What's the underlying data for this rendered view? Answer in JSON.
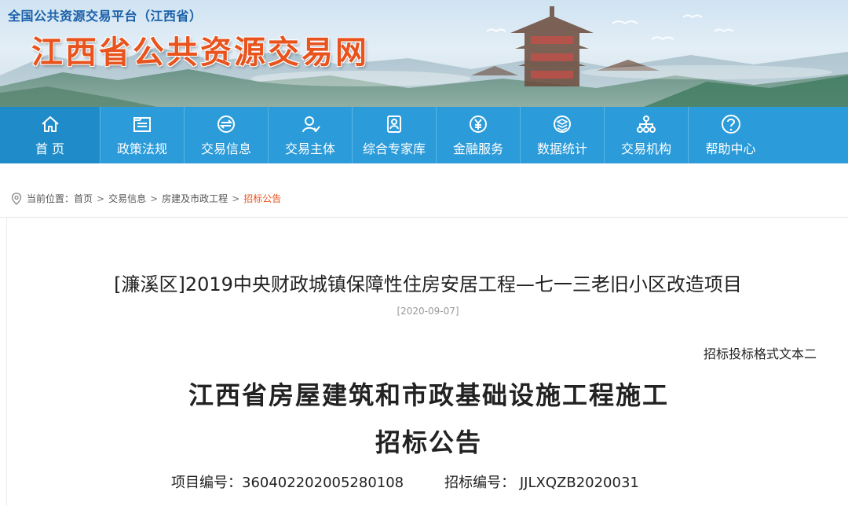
{
  "header": {
    "platform_title": "全国公共资源交易平台（江西省）",
    "site_title": "江西省公共资源交易网"
  },
  "nav": {
    "items": [
      {
        "label": "首 页",
        "icon": "home-icon"
      },
      {
        "label": "政策法规",
        "icon": "document-folder-icon"
      },
      {
        "label": "交易信息",
        "icon": "exchange-icon"
      },
      {
        "label": "交易主体",
        "icon": "user-icon"
      },
      {
        "label": "综合专家库",
        "icon": "id-card-icon"
      },
      {
        "label": "金融服务",
        "icon": "yuan-icon"
      },
      {
        "label": "数据统计",
        "icon": "database-icon"
      },
      {
        "label": "交易机构",
        "icon": "org-chart-icon"
      },
      {
        "label": "帮助中心",
        "icon": "question-icon"
      }
    ]
  },
  "breadcrumb": {
    "prefix": "当前位置：",
    "items": [
      "首页",
      "交易信息",
      "房建及市政工程"
    ],
    "current": "招标公告",
    "separator": ">"
  },
  "article": {
    "title": "[濂溪区]2019中央财政城镇保障性住房安居工程—七一三老旧小区改造项目",
    "date": "[2020-09-07]",
    "format_note": "招标投标格式文本二",
    "doc_title_line1": "江西省房屋建筑和市政基础设施工程施工",
    "doc_title_line2": "招标公告",
    "project_no_label": "项目编号：",
    "project_no": "360402202005280108",
    "bid_no_label": "招标编号：",
    "bid_no": "JJLXQZB2020031"
  },
  "colors": {
    "nav_bg": "#2b9bd9",
    "site_title": "#e8531e",
    "platform_title": "#1a5fa8",
    "active_crumb": "#e8531e"
  }
}
